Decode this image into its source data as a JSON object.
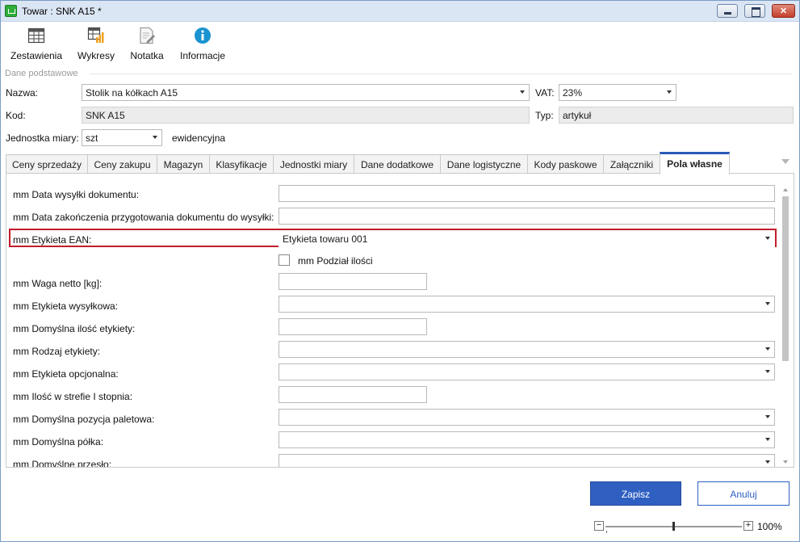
{
  "window": {
    "title": "Towar : SNK A15 *",
    "colors": {
      "titlebar": "#dbe6f4",
      "accent": "#2a59b7",
      "primary_button": "#2f5fc1",
      "highlight": "#c21c2c"
    }
  },
  "toolbar": {
    "items": [
      {
        "label": "Zestawienia",
        "icon": "table-grid-icon"
      },
      {
        "label": "Wykresy",
        "icon": "chart-table-icon"
      },
      {
        "label": "Notatka",
        "icon": "note-pencil-icon"
      },
      {
        "label": "Informacje",
        "icon": "info-circle-icon"
      }
    ]
  },
  "basic": {
    "section_label": "Dane podstawowe",
    "name_label": "Nazwa:",
    "name_value": "Stolik na kółkach A15",
    "vat_label": "VAT:",
    "vat_value": "23%",
    "code_label": "Kod:",
    "code_value": "SNK A15",
    "type_label": "Typ:",
    "type_value": "artykuł",
    "unit_label": "Jednostka miary:",
    "unit_value": "szt",
    "unit_note": "ewidencyjna"
  },
  "tabs": [
    "Ceny sprzedaży",
    "Ceny zakupu",
    "Magazyn",
    "Klasyfikacje",
    "Jednostki miary",
    "Dane dodatkowe",
    "Dane logistyczne",
    "Kody paskowe",
    "Załączniki",
    "Pola własne"
  ],
  "active_tab": "Pola własne",
  "custom_fields": {
    "data_wysylki": {
      "label": "mm Data wysyłki dokumentu:",
      "value": ""
    },
    "data_zakonczenia": {
      "label": "mm Data zakończenia przygotowania dokumentu do wysyłki:",
      "value": ""
    },
    "etykieta_ean": {
      "label": "mm Etykieta EAN:",
      "value": "Etykieta towaru 001"
    },
    "podzial_ilosci": {
      "label": "mm Podział ilości",
      "checked": false
    },
    "waga_netto": {
      "label": "mm Waga netto [kg]:",
      "value": ""
    },
    "etykieta_wysylkowa": {
      "label": "mm Etykieta wysyłkowa:",
      "value": ""
    },
    "domyslna_ilosc": {
      "label": "mm Domyślna ilość etykiety:",
      "value": ""
    },
    "rodzaj_etykiety": {
      "label": "mm Rodzaj etykiety:",
      "value": ""
    },
    "etykieta_opcjonalna": {
      "label": "mm Etykieta opcjonalna:",
      "value": ""
    },
    "ilosc_strefie": {
      "label": "mm Ilość w strefie I stopnia:",
      "value": ""
    },
    "pozycja_paletowa": {
      "label": "mm Domyślna pozycja paletowa:",
      "value": ""
    },
    "polka": {
      "label": "mm Domyślna półka:",
      "value": ""
    },
    "przeslo": {
      "label": "mm Domyślne przesło:",
      "value": ""
    }
  },
  "footer": {
    "save_label": "Zapisz",
    "cancel_label": "Anuluj",
    "zoom_minus": "−",
    "zoom_plus": "+",
    "zoom_value": "100%"
  }
}
